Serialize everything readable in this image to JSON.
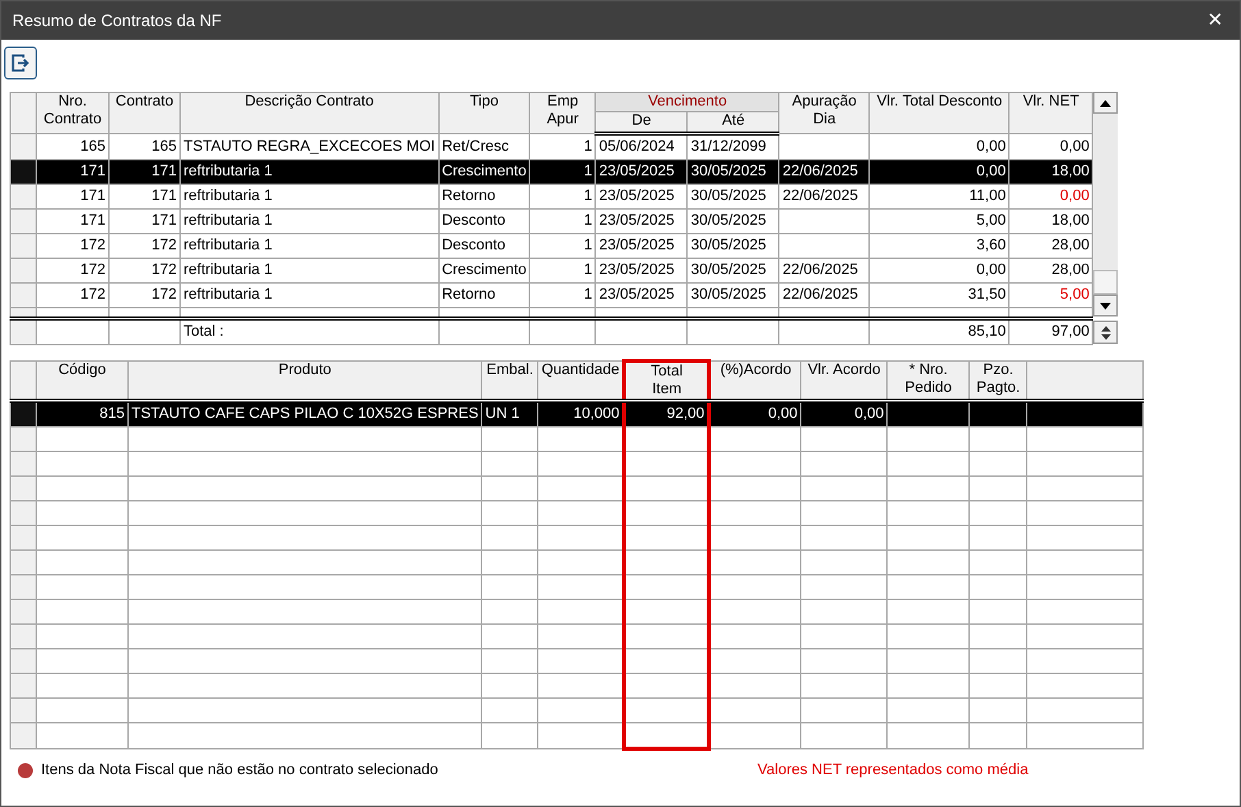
{
  "window": {
    "title": "Resumo de Contratos da NF",
    "close": "✕"
  },
  "contracts": {
    "columns": [
      {
        "kind": "single",
        "label": "Nro.\nContrato"
      },
      {
        "kind": "single",
        "label": "Contrato"
      },
      {
        "kind": "single",
        "label": "Descrição Contrato"
      },
      {
        "kind": "single",
        "label": "Tipo"
      },
      {
        "kind": "single",
        "label": "Emp\nApur"
      },
      {
        "kind": "group",
        "label": "Vencimento",
        "colspan": 2,
        "children": [
          {
            "label": "De"
          },
          {
            "label": "Até"
          }
        ]
      },
      {
        "kind": "single",
        "label": "Apuração\nDia"
      },
      {
        "kind": "single",
        "label": "Vlr. Total Desconto"
      },
      {
        "kind": "single",
        "label": "Vlr. NET"
      }
    ],
    "rows": [
      {
        "selected": false,
        "net_flagged": false,
        "cells": [
          "165",
          "165",
          "TSTAUTO REGRA_EXCECOES MOI",
          "Ret/Cresc",
          "1",
          "05/06/2024",
          "31/12/2099",
          null,
          "0,00",
          "0,00"
        ]
      },
      {
        "selected": true,
        "net_flagged": false,
        "cells": [
          "171",
          "171",
          "reftributaria 1",
          "Crescimento",
          "1",
          "23/05/2025",
          "30/05/2025",
          "22/06/2025",
          "0,00",
          "18,00"
        ]
      },
      {
        "selected": false,
        "net_flagged": true,
        "cells": [
          "171",
          "171",
          "reftributaria 1",
          "Retorno",
          "1",
          "23/05/2025",
          "30/05/2025",
          "22/06/2025",
          "11,00",
          "0,00"
        ]
      },
      {
        "selected": false,
        "net_flagged": false,
        "cells": [
          "171",
          "171",
          "reftributaria 1",
          "Desconto",
          "1",
          "23/05/2025",
          "30/05/2025",
          null,
          "5,00",
          "18,00"
        ]
      },
      {
        "selected": false,
        "net_flagged": false,
        "cells": [
          "172",
          "172",
          "reftributaria 1",
          "Desconto",
          "1",
          "23/05/2025",
          "30/05/2025",
          null,
          "3,60",
          "28,00"
        ]
      },
      {
        "selected": false,
        "net_flagged": false,
        "cells": [
          "172",
          "172",
          "reftributaria 1",
          "Crescimento",
          "1",
          "23/05/2025",
          "30/05/2025",
          "22/06/2025",
          "0,00",
          "28,00"
        ]
      },
      {
        "selected": false,
        "net_flagged": true,
        "cells": [
          "172",
          "172",
          "reftributaria 1",
          "Retorno",
          "1",
          "23/05/2025",
          "30/05/2025",
          "22/06/2025",
          "31,50",
          "5,00"
        ]
      }
    ],
    "totals": {
      "label": "Total :",
      "discount": "85,10",
      "net": "97,00"
    }
  },
  "products": {
    "columns": [
      {
        "label": "Código",
        "highlighted": false
      },
      {
        "label": "Produto",
        "highlighted": false
      },
      {
        "label": "Embal.",
        "highlighted": false
      },
      {
        "label": "Quantidade",
        "highlighted": false
      },
      {
        "label": "Total\nItem",
        "highlighted": true
      },
      {
        "label": "(%)Acordo",
        "highlighted": false
      },
      {
        "label": "Vlr. Acordo",
        "highlighted": false
      },
      {
        "label": "* Nro.\nPedido",
        "highlighted": false
      },
      {
        "label": "Pzo.\nPagto.",
        "highlighted": false
      }
    ],
    "rows": [
      {
        "selected": true,
        "cells": [
          "815",
          "TSTAUTO CAFE CAPS PILAO C 10X52G ESPRES",
          "UN 1",
          "10,000",
          "92,00",
          "0,00",
          "0,00",
          null,
          null
        ]
      }
    ]
  },
  "legend": {
    "text": "Itens da Nota Fiscal que não estão no contrato selecionado",
    "color": "#b83b3b"
  },
  "note": "Valores NET representados como média"
}
